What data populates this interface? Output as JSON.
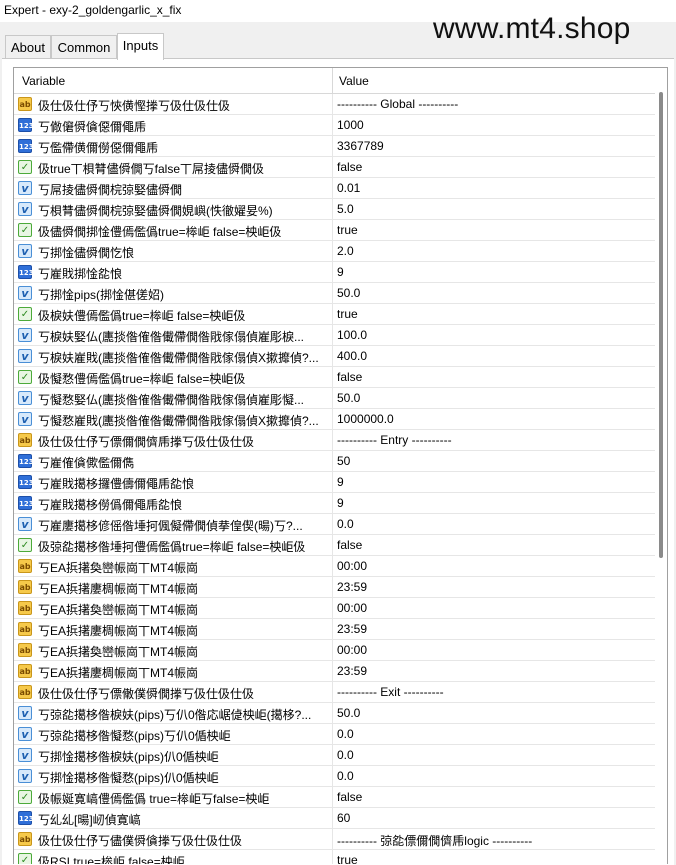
{
  "window": {
    "title": "Expert - exy-2_goldengarlic_x_fix"
  },
  "watermark": "www.mt4.shop",
  "tabs": [
    "About",
    "Common",
    "Inputs"
  ],
  "columns": {
    "variable": "Variable",
    "value": "Value"
  },
  "rows": [
    {
      "icon": "ab",
      "name": "伋仕伋仕伃丂悏僙慳搼丂伋仕伋仕伋",
      "value": "---------- Global ----------"
    },
    {
      "icon": "123",
      "name": "丂僘僒僢僋僫儞僶乕",
      "value": "1000"
    },
    {
      "icon": "123",
      "name": "丂儖僀僙儞僗僫儞僶乕",
      "value": "3367789"
    },
    {
      "icon": "bool",
      "name": "伋true丅梖甧儘僢僩丂false丅屌掕儘僢僩伋",
      "value": "false"
    },
    {
      "icon": "real",
      "name": "丂屌掕儘僢僩梡弶婜儘僢僩",
      "value": "0.01"
    },
    {
      "icon": "real",
      "name": "丂梖甧儘僢僩梡弶婜儘僢僩娊嶼(怢徹嬥妟%)",
      "value": "5.0"
    },
    {
      "icon": "bool",
      "name": "伋儘僢僩挷惍僼傿儖僞true=桳岠 false=柍岠伋",
      "value": "true"
    },
    {
      "icon": "real",
      "name": "丂挷惍儘僢僩忔悢",
      "value": "2.0"
    },
    {
      "icon": "123",
      "name": "丂嵟戝挷惍夞悢",
      "value": "9"
    },
    {
      "icon": "real",
      "name": "丂挷惍pips(挷惍偡傞妱)",
      "value": "50.0"
    },
    {
      "icon": "bool",
      "name": "伋棙妋僼傿儖僞true=桳岠 false=柍岠伋",
      "value": "true"
    },
    {
      "icon": "real",
      "name": "丂棙妋婜仏(廤掞偺傕偺儎僀僩偺戙傢傝偵嵟彫棙...",
      "value": "100.0"
    },
    {
      "icon": "real",
      "name": "丂棙妋嵟戝(廤掞偺傕偺儎僀僩偺戙傢傝偵X摗攠偵?...",
      "value": "400.0"
    },
    {
      "icon": "bool",
      "name": "伋懝愗僼傿儖僞true=桳岠 false=柍岠伋",
      "value": "false"
    },
    {
      "icon": "real",
      "name": "丂懝愗婜仏(廤掞偺傕偺儎僀僩偺戙傢傝偵嵟彫懝...",
      "value": "50.0"
    },
    {
      "icon": "real",
      "name": "丂懝愗嵟戝(廤掞偺傕偺儎僀僩偺戙傢傝偵X摗攠偵?...",
      "value": "1000000.0"
    },
    {
      "icon": "ab",
      "name": "伋仕伋仕伃丂僄儞僩儕乕搼丂伋仕伋仕伋",
      "value": "---------- Entry ----------"
    },
    {
      "icon": "123",
      "name": "丂嵟傕僋僛儖儞儁",
      "value": "50"
    },
    {
      "icon": "123",
      "name": "丂嵟戝擖栘攞僼儔儞僶乕夞悢",
      "value": "9"
    },
    {
      "icon": "123",
      "name": "丂嵟戝擖栘僗僞儞僶乕夞悢",
      "value": "9"
    },
    {
      "icon": "real",
      "name": "丂嵟廔擖栘偐傜偺埵抲偑儗僀僩偵拲偟偰(暘)丂?...",
      "value": "0.0"
    },
    {
      "icon": "bool",
      "name": "伋弶夞擖栘偺埵抲僼傿儖僞true=桳岠 false=柍岠伋",
      "value": "false"
    },
    {
      "icon": "ab",
      "name": "丂EA捠擆奐巒帪崗丅MT4帪崗",
      "value": "00:00"
    },
    {
      "icon": "ab",
      "name": "丂EA捠擆廔椆帪崗丅MT4帪崗",
      "value": "23:59"
    },
    {
      "icon": "ab",
      "name": "丂EA捠擆奐巒帪崗丅MT4帪崗",
      "value": "00:00"
    },
    {
      "icon": "ab",
      "name": "丂EA捠擆廔椆帪崗丅MT4帪崗",
      "value": "23:59"
    },
    {
      "icon": "ab",
      "name": "丂EA捠擆奐巒帪崗丅MT4帪崗",
      "value": "00:00"
    },
    {
      "icon": "ab",
      "name": "丂EA捠擆廔椆帪崗丅MT4帪崗",
      "value": "23:59"
    },
    {
      "icon": "ab",
      "name": "伋仕伋仕伃丂僄僌僕僢僩搼丂伋仕伋仕伋",
      "value": "---------- Exit ----------"
    },
    {
      "icon": "real",
      "name": "丂弶夞擖栘偺棙妋(pips)丂仈0偺応崌偼柍岠(擖栘?...",
      "value": "50.0"
    },
    {
      "icon": "real",
      "name": "丂弶夞擖栘偺懝愗(pips)丂仈0偱柍岠",
      "value": "0.0"
    },
    {
      "icon": "real",
      "name": "丂挷惍擖栘偺棙妋(pips)仈0偱柍岠",
      "value": "0.0"
    },
    {
      "icon": "real",
      "name": "丂挷惍擖栘偺懝愗(pips)仈0偱柍岠",
      "value": "0.0"
    },
    {
      "icon": "bool",
      "name": "伋帪娫寛嵪僼傿儖僞 true=桳岠丂false=柍岠",
      "value": "false"
    },
    {
      "icon": "123",
      "name": "丂乣乣[暘]屻偵寛嵪",
      "value": "60"
    },
    {
      "icon": "ab",
      "name": "伋仕伋仕伃丂儘僕僢僋搼丂伋仕伋仕伋",
      "value": "---------- 弶夞僄儞僩儕乕logic ----------"
    },
    {
      "icon": "bool",
      "name": "伋RSI true=桳岠 false=柍岠",
      "value": "true"
    }
  ]
}
